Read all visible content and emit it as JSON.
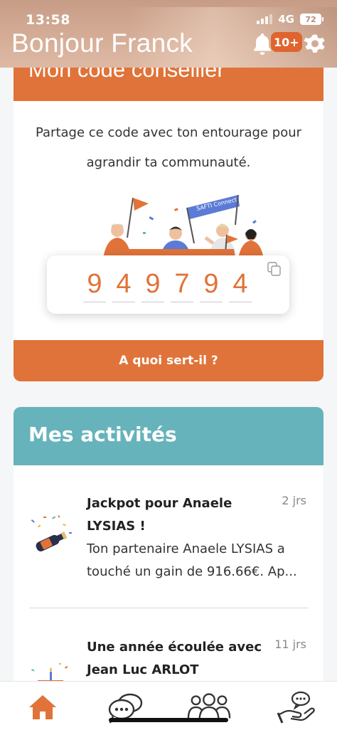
{
  "status_bar": {
    "time": "13:58",
    "network": "4G",
    "battery": "72"
  },
  "header": {
    "greeting": "Bonjour Franck",
    "notification_count": "10+"
  },
  "code_card": {
    "title": "Mon code conseiller",
    "intro_line1": "Partage ce code avec ton entourage pour",
    "intro_line2": "agrandir ta communauté.",
    "banner_text": "SAFTI Connect",
    "digits": [
      "9",
      "4",
      "9",
      "7",
      "9",
      "4"
    ],
    "help_label": "A quoi sert-il ?"
  },
  "activities": {
    "title": "Mes activités",
    "items": [
      {
        "title_line1": "Jackpot pour Anaele",
        "title_line2": "LYSIAS !",
        "body_line1": "Ton partenaire Anaele LYSIAS a",
        "body_line2": "touché un gain de 916.66€. Ap...",
        "time": "2 jrs",
        "icon": "champagne-icon"
      },
      {
        "title_line1": "Une année écoulée avec",
        "title_line2": "Jean Luc ARLOT",
        "time": "11 jrs",
        "icon": "birthday-cake-icon"
      }
    ]
  },
  "tabbar": {
    "items": [
      {
        "icon": "home-icon",
        "active": true
      },
      {
        "icon": "chat-icon",
        "active": false
      },
      {
        "icon": "community-icon",
        "active": false
      },
      {
        "icon": "support-hand-icon",
        "active": false
      }
    ]
  },
  "colors": {
    "accent": "#e07339",
    "teal": "#66b3bb",
    "header": "#d2a893"
  }
}
